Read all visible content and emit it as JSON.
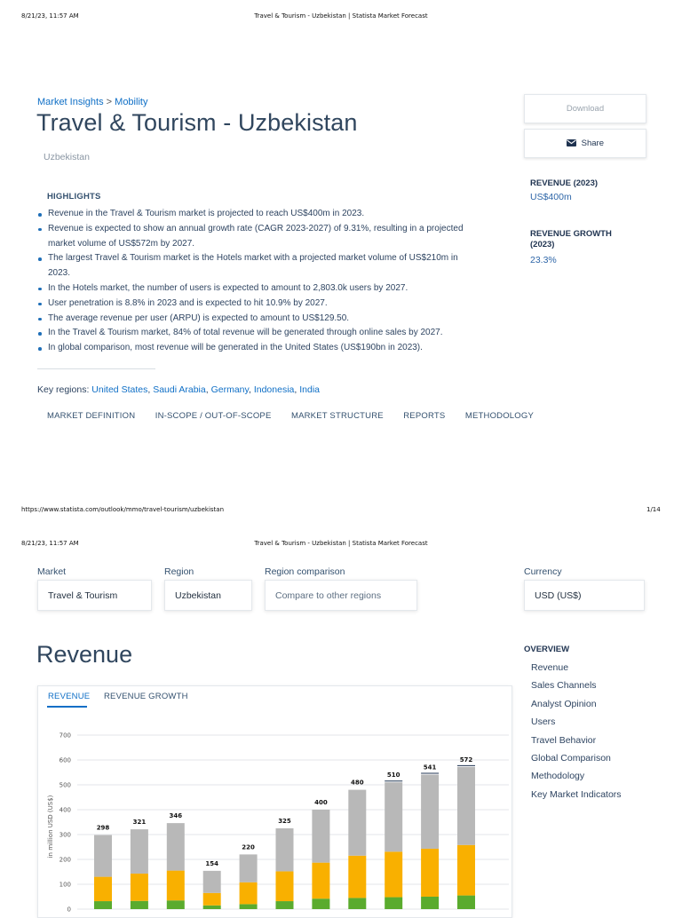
{
  "page1": {
    "print_header": {
      "datetime": "8/21/23, 11:57 AM",
      "title": "Travel & Tourism - Uzbekistan | Statista Market Forecast"
    },
    "breadcrumb": {
      "part1": "Market Insights",
      "sep": ">",
      "part2": "Mobility"
    },
    "title": "Travel & Tourism - Uzbekistan",
    "subtitle": "Uzbekistan",
    "highlights_heading": "HIGHLIGHTS",
    "highlights": [
      {
        "line1": "Revenue in the Travel & Tourism market is projected to reach US$400m in 2023.",
        "line2": ""
      },
      {
        "line1": "Revenue is expected to show an annual growth rate (CAGR 2023-2027) of 9.31%, resulting in a projected",
        "line2": "market volume of US$572m by 2027."
      },
      {
        "line1": "The largest Travel & Tourism market is the Hotels market with a projected market volume of US$210m in",
        "line2": "2023."
      },
      {
        "line1": "In the Hotels market, the number of users is expected to amount to 2,803.0k users by 2027.",
        "line2": ""
      },
      {
        "line1": "User penetration is 8.8% in 2023 and is expected to hit 10.9% by 2027.",
        "line2": ""
      },
      {
        "line1": "The average revenue per user (ARPU) is expected to amount to US$129.50.",
        "line2": ""
      },
      {
        "line1": "In the Travel & Tourism market, 84% of total revenue will be generated through online sales by 2027.",
        "line2": ""
      },
      {
        "line1": "In global comparison, most revenue will be generated in the United States (US$190bn in 2023).",
        "line2": ""
      }
    ],
    "key_regions_label": "Key regions:",
    "key_regions": [
      "United States",
      "Saudi Arabia",
      "Germany",
      "Indonesia",
      "India"
    ],
    "nav_tabs": [
      "MARKET DEFINITION",
      "IN-SCOPE / OUT-OF-SCOPE",
      "MARKET STRUCTURE",
      "REPORTS",
      "METHODOLOGY"
    ],
    "download_label": "Download",
    "share_label": "Share",
    "kpis": [
      {
        "heading": "REVENUE (2023)",
        "value": "US$400m"
      },
      {
        "heading_line1": "REVENUE GROWTH",
        "heading_line2": "(2023)",
        "value": "23.3%"
      }
    ],
    "footer": {
      "url": "https://www.statista.com/outlook/mmo/travel-tourism/uzbekistan",
      "page": "1/14"
    }
  },
  "page2": {
    "print_header": {
      "datetime": "8/21/23, 11:57 AM",
      "title": "Travel & Tourism - Uzbekistan | Statista Market Forecast"
    },
    "selectors": [
      {
        "label": "Market",
        "value": "Travel & Tourism"
      },
      {
        "label": "Region",
        "value": "Uzbekistan"
      },
      {
        "label": "Region comparison",
        "value": "Compare to other regions"
      },
      {
        "label": "Currency",
        "value": "USD (US$)"
      }
    ],
    "revenue_title": "Revenue",
    "chart_tabs": [
      {
        "label": "REVENUE",
        "active": true
      },
      {
        "label": "REVENUE GROWTH",
        "active": false
      }
    ],
    "overview_heading": "OVERVIEW",
    "overview_items": [
      "Revenue",
      "Sales Channels",
      "Analyst Opinion",
      "Users",
      "Travel Behavior",
      "Global Comparison",
      "Methodology",
      "Key Market Indicators"
    ]
  },
  "colors": {
    "link": "#0f6fc6",
    "grey": "#b8b8b8",
    "orange": "#f9b000",
    "green": "#5aab2e"
  },
  "chart_data": {
    "type": "bar",
    "stacked": true,
    "ylabel": "in million USD (US$)",
    "ylim": [
      0,
      700
    ],
    "yticks": [
      0,
      100,
      200,
      300,
      400,
      500,
      600,
      700
    ],
    "totals": [
      298,
      321,
      346,
      154,
      220,
      325,
      400,
      480,
      510,
      541,
      572
    ],
    "series": [
      {
        "color": "#5aab2e",
        "values": [
          32,
          33,
          35,
          15,
          20,
          32,
          42,
          45,
          48,
          50,
          55
        ]
      },
      {
        "color": "#f9b000",
        "values": [
          98,
          110,
          120,
          50,
          88,
          120,
          145,
          170,
          183,
          193,
          203
        ]
      },
      {
        "color": "#b8b8b8",
        "values": [
          168,
          178,
          191,
          89,
          112,
          173,
          213,
          265,
          279,
          298,
          314
        ]
      }
    ]
  }
}
